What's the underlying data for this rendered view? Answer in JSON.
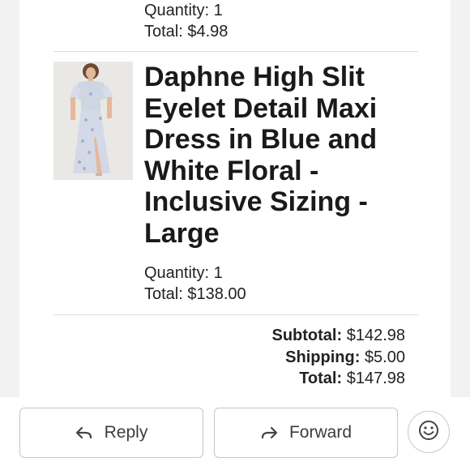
{
  "previous_item": {
    "quantity": "Quantity: 1",
    "total": "Total: $4.98"
  },
  "item": {
    "title": "Daphne High Slit Eyelet Detail Maxi Dress in Blue and White Floral - Inclusive Sizing - Large",
    "quantity": "Quantity: 1",
    "total": "Total: $138.00",
    "image_icon": "dress-photo"
  },
  "totals": {
    "subtotal_label": "Subtotal:",
    "subtotal_value": "$142.98",
    "shipping_label": "Shipping:",
    "shipping_value": "$5.00",
    "total_label": "Total:",
    "total_value": "$147.98"
  },
  "actions": {
    "reply_label": "Reply",
    "forward_label": "Forward",
    "reply_icon": "reply-arrow-icon",
    "forward_icon": "forward-arrow-icon",
    "emoji_icon": "smiley-icon"
  }
}
